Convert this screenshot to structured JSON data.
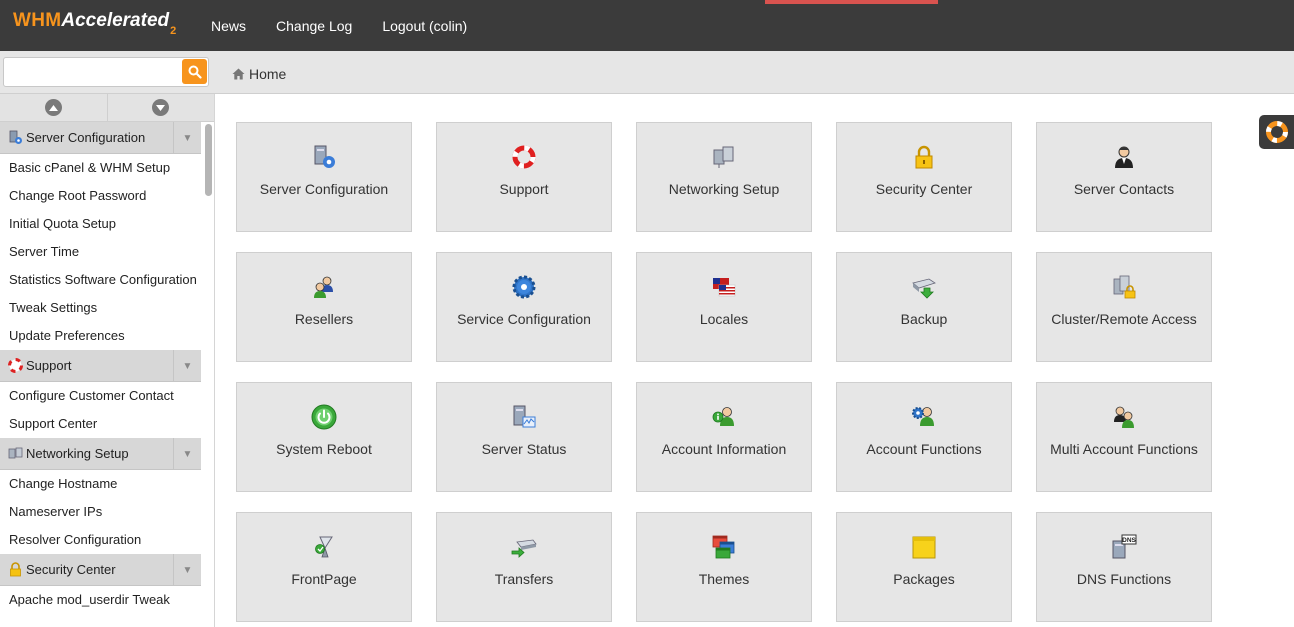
{
  "header": {
    "logo_main": "WHM",
    "logo_accent": "Accelerated",
    "logo_sub": "2",
    "nav": [
      "News",
      "Change Log",
      "Logout (colin)"
    ]
  },
  "search": {
    "value": "",
    "placeholder": ""
  },
  "breadcrumb": {
    "home": "Home"
  },
  "sidebar": {
    "sections": [
      {
        "title": "Server Configuration",
        "icon": "server-config-icon",
        "items": [
          "Basic cPanel & WHM Setup",
          "Change Root Password",
          "Initial Quota Setup",
          "Server Time",
          "Statistics Software Configuration",
          "Tweak Settings",
          "Update Preferences"
        ]
      },
      {
        "title": "Support",
        "icon": "lifebuoy-icon",
        "items": [
          "Configure Customer Contact",
          "Support Center"
        ]
      },
      {
        "title": "Networking Setup",
        "icon": "network-icon",
        "items": [
          "Change Hostname",
          "Nameserver IPs",
          "Resolver Configuration"
        ]
      },
      {
        "title": "Security Center",
        "icon": "lock-icon",
        "items": [
          "Apache mod_userdir Tweak"
        ]
      }
    ]
  },
  "tiles": [
    {
      "label": "Server Configuration",
      "icon": "server-gear-icon"
    },
    {
      "label": "Support",
      "icon": "lifebuoy-icon"
    },
    {
      "label": "Networking Setup",
      "icon": "network-computers-icon"
    },
    {
      "label": "Security Center",
      "icon": "padlock-icon"
    },
    {
      "label": "Server Contacts",
      "icon": "contact-person-icon"
    },
    {
      "label": "Resellers",
      "icon": "resellers-people-icon"
    },
    {
      "label": "Service Configuration",
      "icon": "gear-icon"
    },
    {
      "label": "Locales",
      "icon": "flag-icon"
    },
    {
      "label": "Backup",
      "icon": "backup-drive-icon"
    },
    {
      "label": "Cluster/Remote Access",
      "icon": "cluster-lock-icon"
    },
    {
      "label": "System Reboot",
      "icon": "power-icon"
    },
    {
      "label": "Server Status",
      "icon": "server-status-icon"
    },
    {
      "label": "Account Information",
      "icon": "account-info-icon"
    },
    {
      "label": "Account Functions",
      "icon": "account-gear-icon"
    },
    {
      "label": "Multi Account Functions",
      "icon": "multi-account-icon"
    },
    {
      "label": "FrontPage",
      "icon": "frontpage-icon"
    },
    {
      "label": "Transfers",
      "icon": "transfers-icon"
    },
    {
      "label": "Themes",
      "icon": "themes-windows-icon"
    },
    {
      "label": "Packages",
      "icon": "package-box-icon"
    },
    {
      "label": "DNS Functions",
      "icon": "dns-server-icon"
    }
  ],
  "colors": {
    "topbar": "#3b3b3b",
    "accent": "#f7941d",
    "tile_bg": "#e6e6e6",
    "section_bg": "#d7d7d7"
  }
}
